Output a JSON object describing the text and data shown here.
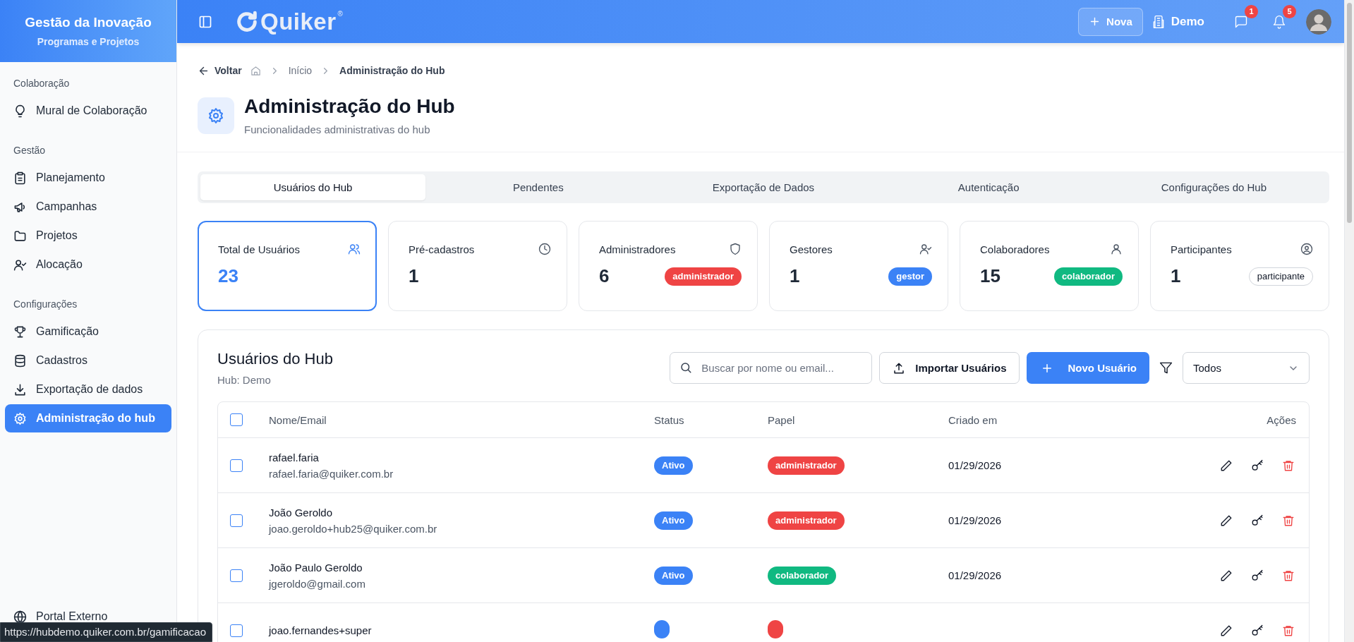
{
  "sidebar": {
    "title": "Gestão da Inovação",
    "subtitle": "Programas e Projetos",
    "sections": [
      {
        "heading": "Colaboração",
        "items": [
          {
            "label": "Mural de Colaboração",
            "kind": "bulb",
            "selected": false
          }
        ]
      },
      {
        "heading": "Gestão",
        "items": [
          {
            "label": "Planejamento",
            "kind": "clipboard",
            "selected": false
          },
          {
            "label": "Campanhas",
            "kind": "megaphone",
            "selected": false
          },
          {
            "label": "Projetos",
            "kind": "folder",
            "selected": false
          },
          {
            "label": "Alocação",
            "kind": "usercheck",
            "selected": false
          }
        ]
      },
      {
        "heading": "Configurações",
        "items": [
          {
            "label": "Gamificação",
            "kind": "trophy",
            "selected": false
          },
          {
            "label": "Cadastros",
            "kind": "database",
            "selected": false
          },
          {
            "label": "Exportação de dados",
            "kind": "download",
            "selected": false
          },
          {
            "label": "Administração do hub",
            "kind": "gear",
            "selected": true
          }
        ]
      }
    ],
    "footer_item": {
      "label": "Portal Externo",
      "kind": "globe"
    }
  },
  "topbar": {
    "logo": "Quiker",
    "logo_mark": "®",
    "new_button": "Nova",
    "org": "Demo",
    "messages_count": "1",
    "notifications_count": "5"
  },
  "breadcrumb": {
    "back": "Voltar",
    "items": [
      {
        "label": "Início",
        "current": false
      },
      {
        "label": "Administração do Hub",
        "current": true
      }
    ]
  },
  "page": {
    "title": "Administração do Hub",
    "subtitle": "Funcionalidades administrativas do hub"
  },
  "tabs": [
    {
      "label": "Usuários do Hub",
      "selected": true
    },
    {
      "label": "Pendentes",
      "selected": false
    },
    {
      "label": "Exportação de Dados",
      "selected": false
    },
    {
      "label": "Autenticação",
      "selected": false
    },
    {
      "label": "Configurações do Hub",
      "selected": false
    }
  ],
  "stats": [
    {
      "label": "Total de Usuários",
      "value": "23",
      "kind": "users",
      "selected": true
    },
    {
      "label": "Pré-cadastros",
      "value": "1",
      "kind": "clock",
      "selected": false
    },
    {
      "label": "Administradores",
      "value": "6",
      "kind": "shield",
      "selected": false,
      "badge": {
        "label": "administrador",
        "kind": "admin"
      }
    },
    {
      "label": "Gestores",
      "value": "1",
      "kind": "usercheck",
      "selected": false,
      "badge": {
        "label": "gestor",
        "kind": "manager"
      }
    },
    {
      "label": "Colaboradores",
      "value": "15",
      "kind": "user",
      "selected": false,
      "badge": {
        "label": "colaborador",
        "kind": "collaborator"
      }
    },
    {
      "label": "Participantes",
      "value": "1",
      "kind": "usercircle",
      "selected": false,
      "badge": {
        "label": "participante",
        "kind": "participant"
      }
    }
  ],
  "users_panel": {
    "title": "Usuários do Hub",
    "hub": "Hub: Demo",
    "search": {
      "placeholder": "Buscar por nome ou email..."
    },
    "import_button": "Importar Usuários",
    "new_button": "Novo Usuário",
    "filter": {
      "value": "Todos"
    },
    "table": {
      "header_checked": false,
      "columns": [
        "Nome/Email",
        "Status",
        "Papel",
        "Criado em",
        "Ações"
      ],
      "rows": [
        {
          "checked": false,
          "name": "rafael.faria",
          "email": "rafael.faria@quiker.com.br",
          "status": {
            "label": "Ativo",
            "kind": "active"
          },
          "role": {
            "label": "administrador",
            "kind": "admin"
          },
          "created": "01/29/2026"
        },
        {
          "checked": false,
          "name": "João Geroldo",
          "email": "joao.geroldo+hub25@quiker.com.br",
          "status": {
            "label": "Ativo",
            "kind": "active"
          },
          "role": {
            "label": "administrador",
            "kind": "admin"
          },
          "created": "01/29/2026"
        },
        {
          "checked": false,
          "name": "João Paulo Geroldo",
          "email": "jgeroldo@gmail.com",
          "status": {
            "label": "Ativo",
            "kind": "active"
          },
          "role": {
            "label": "colaborador",
            "kind": "collaborator"
          },
          "created": "01/29/2026"
        },
        {
          "checked": false,
          "name": "joao.fernandes+super",
          "status": {
            "kind": "active"
          },
          "role": {
            "kind": "admin"
          }
        }
      ]
    }
  },
  "status_url": "https://hubdemo.quiker.com.br/gamificacao"
}
